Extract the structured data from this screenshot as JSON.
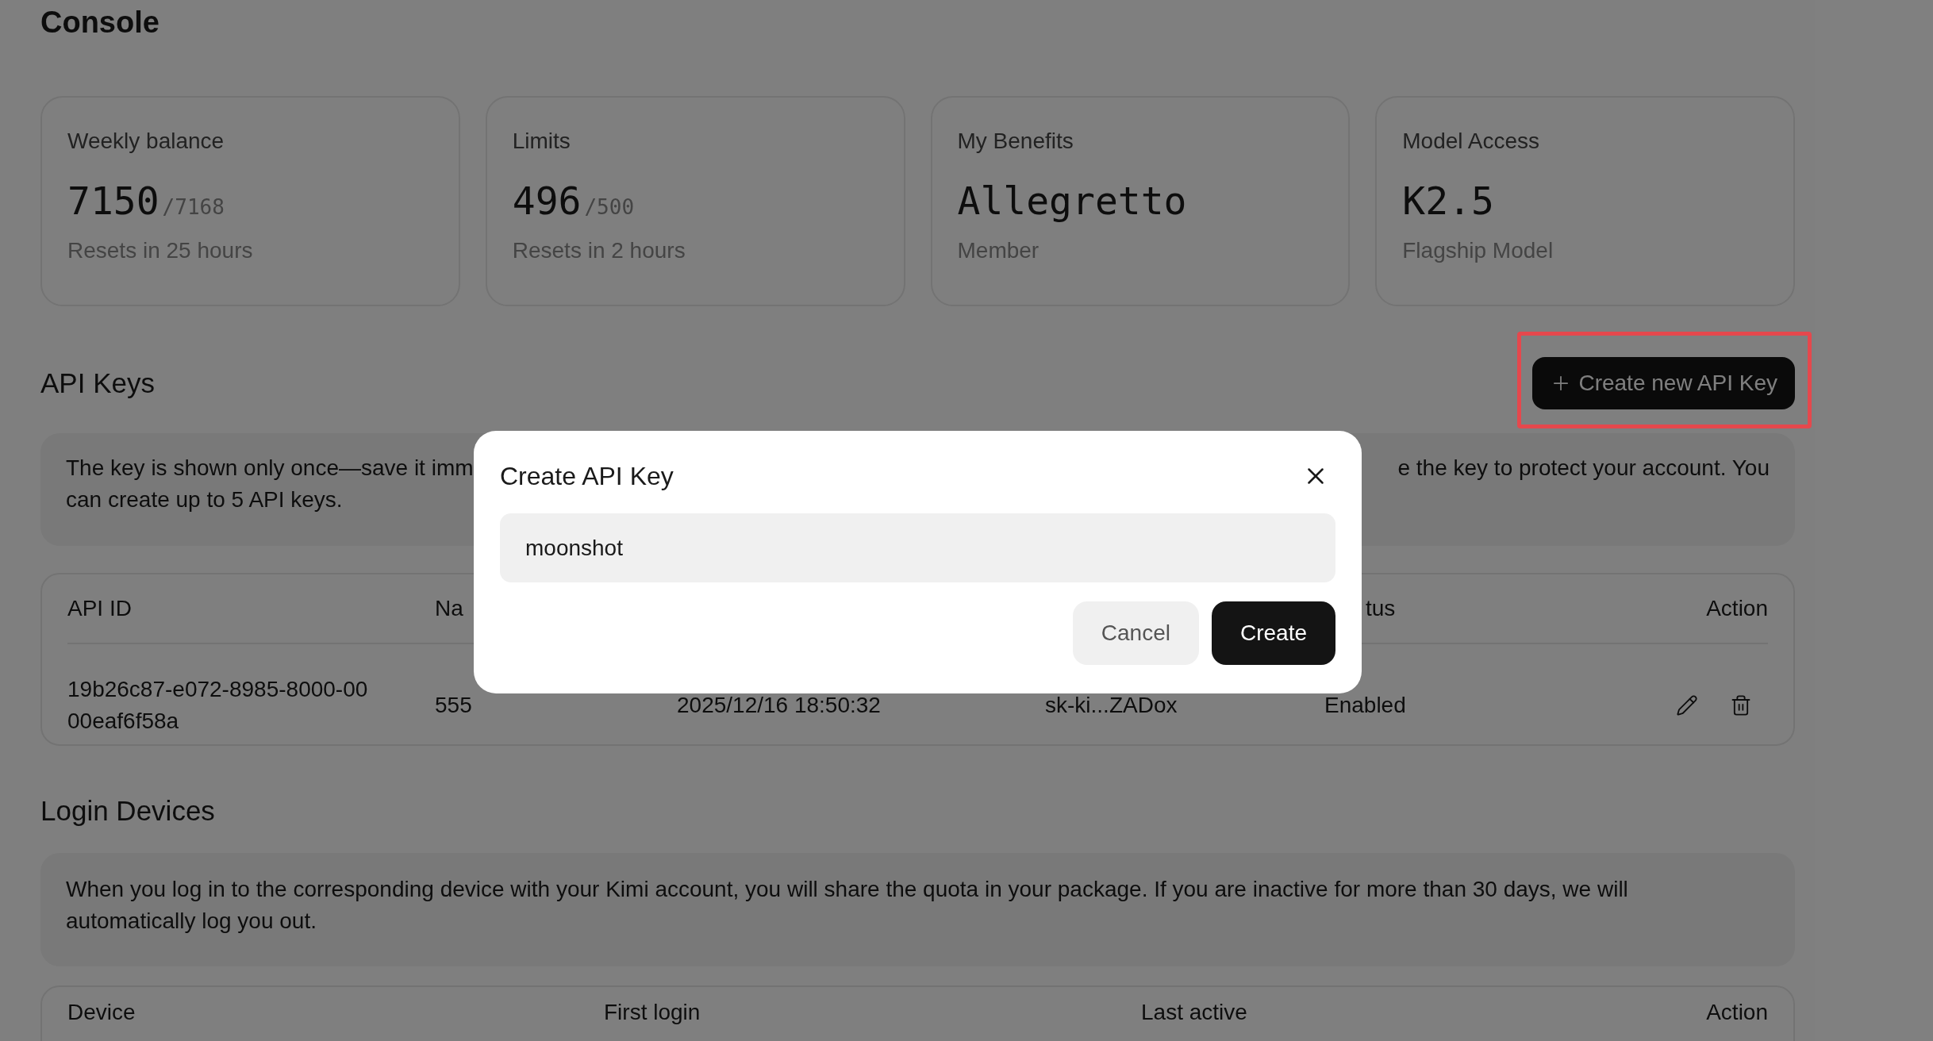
{
  "page": {
    "title": "Console"
  },
  "cards": [
    {
      "label": "Weekly balance",
      "value": "7150",
      "total": "/7168",
      "note": "Resets in 25 hours"
    },
    {
      "label": "Limits",
      "value": "496",
      "total": "/500",
      "note": "Resets in 2 hours"
    },
    {
      "label": "My Benefits",
      "value": "Allegretto",
      "note": "Member"
    },
    {
      "label": "Model Access",
      "value": "K2.5",
      "note": "Flagship Model"
    }
  ],
  "api_keys": {
    "title": "API Keys",
    "create_button": "Create new API Key",
    "highlighted": true,
    "notice": {
      "left_line_1": "The key is shown only once—save it imm",
      "left_line_2": "can create up to 5 API keys.",
      "right_line_1": "e the key to protect your account. You"
    },
    "columns": [
      "API ID",
      "Na",
      "tus",
      "Action"
    ],
    "rows": [
      {
        "api_id": "19b26c87-e072-8985-8000-0000eaf6f58a",
        "name": "555",
        "created": "2025/12/16 18:50:32",
        "key": "sk-ki...ZADox",
        "status": "Enabled"
      }
    ]
  },
  "login_devices": {
    "title": "Login Devices",
    "notice": "When you log in to the corresponding device with your Kimi account, you will share the quota in your package. If you are inactive for more than 30 days, we will automatically log you out.",
    "columns": [
      "Device",
      "First login",
      "Last active",
      "Action"
    ]
  },
  "dialog": {
    "title": "Create API Key",
    "input_value": "moonshot",
    "buttons": [
      "Cancel",
      "Create"
    ]
  }
}
